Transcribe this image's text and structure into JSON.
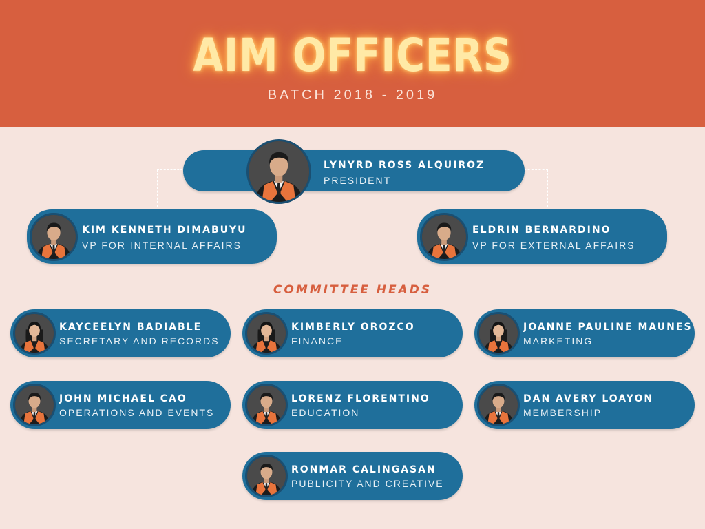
{
  "header": {
    "title": "AIM OFFICERS",
    "subtitle": "BATCH 2018 - 2019"
  },
  "colors": {
    "header_bg": "#d75f3f",
    "page_bg": "#f6e4de",
    "card_bg": "#1f6f9b",
    "accent_text": "#d75f3f",
    "title_glow": "#ffe9a6"
  },
  "president": {
    "name": "LYNYRD ROSS ALQUIROZ",
    "role": "PRESIDENT"
  },
  "vps": [
    {
      "name": "KIM KENNETH DIMABUYU",
      "role": "VP FOR INTERNAL AFFAIRS"
    },
    {
      "name": "ELDRIN BERNARDINO",
      "role": "VP FOR EXTERNAL AFFAIRS"
    }
  ],
  "committee_heading": "COMMITTEE HEADS",
  "committee": [
    {
      "name": "KAYCEELYN BADIABLE",
      "role": "SECRETARY AND RECORDS"
    },
    {
      "name": "KIMBERLY OROZCO",
      "role": "FINANCE"
    },
    {
      "name": "JOANNE PAULINE MAUNES",
      "role": "MARKETING"
    },
    {
      "name": "JOHN MICHAEL CAO",
      "role": "OPERATIONS AND EVENTS"
    },
    {
      "name": "LORENZ FLORENTINO",
      "role": "EDUCATION"
    },
    {
      "name": "DAN AVERY LOAYON",
      "role": "MEMBERSHIP"
    },
    {
      "name": "RONMAR CALINGASAN",
      "role": "PUBLICITY AND CREATIVE"
    }
  ]
}
